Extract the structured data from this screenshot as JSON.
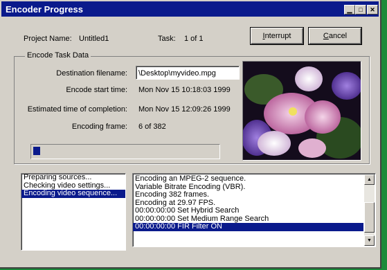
{
  "window": {
    "title": "Encoder Progress",
    "minimize": "▁",
    "maximize": "□",
    "close": "✕"
  },
  "header": {
    "project_label": "Project Name:",
    "project_value": "Untitled1",
    "task_label": "Task:",
    "task_value": "1 of 1",
    "interrupt_mnemonic": "I",
    "interrupt_rest": "nterrupt",
    "cancel_mnemonic": "C",
    "cancel_rest": "ancel"
  },
  "group": {
    "title": "Encode Task Data",
    "dest_label": "Destination filename:",
    "dest_value": "\\Desktop\\myvideo.mpg",
    "start_label": "Encode start time:",
    "start_value": "Mon Nov 15 10:18:03 1999",
    "eta_label": "Estimated time of completion:",
    "eta_value": "Mon Nov 15 12:09:26 1999",
    "frame_label": "Encoding frame:",
    "frame_value": "6 of 382",
    "progress_fraction": 0.016
  },
  "steps": [
    {
      "label": "Preparing sources...",
      "selected": false
    },
    {
      "label": "Checking video settings...",
      "selected": false
    },
    {
      "label": "Encoding video sequence...",
      "selected": true
    }
  ],
  "log": [
    {
      "text": "Encoding an MPEG-2 sequence.",
      "selected": false
    },
    {
      "text": "Variable Bitrate Encoding (VBR).",
      "selected": false
    },
    {
      "text": "Encoding 382 frames.",
      "selected": false
    },
    {
      "text": "Encoding at 29.97 FPS.",
      "selected": false
    },
    {
      "text": "00:00:00:00  Set Hybrid Search",
      "selected": false
    },
    {
      "text": "00:00:00:00  Set Medium Range Search",
      "selected": false
    },
    {
      "text": "00:00:00:00  FIR Filter ON",
      "selected": true
    }
  ],
  "scroll": {
    "up": "▲",
    "down": "▼"
  }
}
